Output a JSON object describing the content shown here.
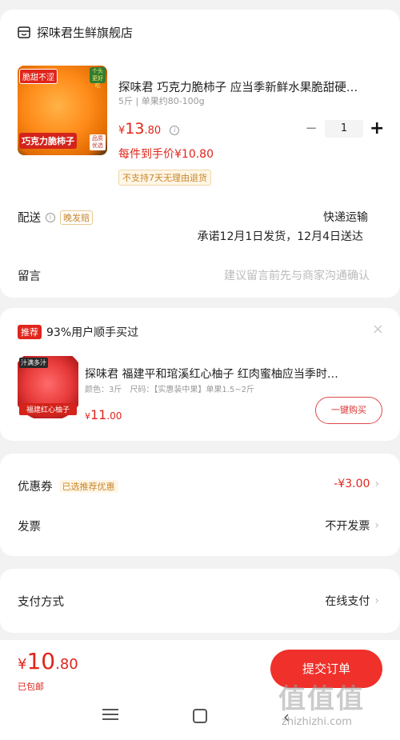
{
  "store": {
    "name": "探味君生鲜旗舰店",
    "product": {
      "image_tags": {
        "top_left": "脆甜不涩",
        "top_right": "个头更好吃",
        "bottom": "巧克力脆柿子",
        "bottom_right": "品质优选"
      },
      "title": "探味君 巧克力脆柿子 应当季新鲜水果脆甜硬…",
      "spec": "5斤 | 单果约80-100g",
      "price": {
        "currency": "¥",
        "integer": "13",
        "decimal": ".80"
      },
      "final_price": "每件到手价¥10.80",
      "no_return_tag": "不支持7天无理由退货",
      "quantity": "1",
      "minus": "−",
      "plus": "+"
    },
    "delivery": {
      "label": "配送",
      "badge": "晚发赔",
      "method": "快递运输",
      "promise": "承诺12月1日发货，12月4日送达"
    },
    "message": {
      "label": "留言",
      "placeholder": "建议留言前先与商家沟通确认"
    }
  },
  "recommend": {
    "badge": "推荐",
    "text": "93%用户顺手买过",
    "close": "×",
    "product": {
      "image_tags": {
        "top": "汁满多汁",
        "bottom": "福建红心柚子"
      },
      "title": "探味君 福建平和琯溪红心柚子 红肉蜜柚应当季时…",
      "spec": "颜色：3斤　尺码：【实惠装中果】单果1.5~2斤",
      "price": {
        "currency": "¥",
        "integer": "11",
        "decimal": ".00"
      },
      "buy_label": "一键购买"
    }
  },
  "coupon": {
    "label": "优惠券",
    "badge": "已选推荐优惠",
    "value": "-¥3.00"
  },
  "invoice": {
    "label": "发票",
    "value": "不开发票"
  },
  "payment": {
    "label": "支付方式",
    "value": "在线支付"
  },
  "footer": {
    "total": {
      "currency": "¥",
      "integer": "10",
      "decimal": ".80"
    },
    "shipping": "已包邮",
    "submit": "提交订单",
    "watermark": {
      "glyph": "值值值",
      "site": "zhizhizhi.com"
    }
  },
  "colors": {
    "accent": "#e0251b",
    "button": "#f0302a",
    "tag_gold": "#c8862c"
  }
}
